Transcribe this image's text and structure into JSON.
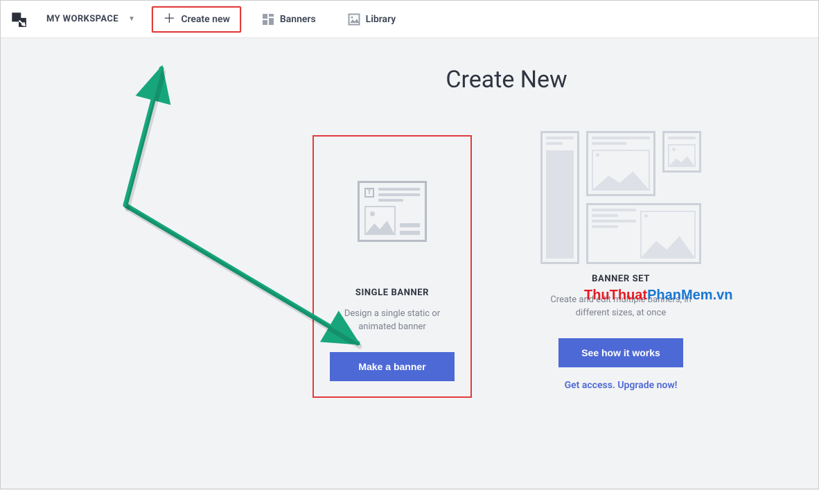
{
  "topbar": {
    "workspace_label": "MY WORKSPACE",
    "create_new_label": "Create new",
    "banners_label": "Banners",
    "library_label": "Library"
  },
  "page": {
    "title": "Create New"
  },
  "cards": {
    "single": {
      "title": "SINGLE BANNER",
      "desc": "Design a single static or animated banner",
      "button": "Make a banner"
    },
    "set": {
      "title": "BANNER SET",
      "desc": "Create and edit multiple banners, in different sizes, at once",
      "button": "See how it works",
      "upgrade_link": "Get access. Upgrade now!"
    }
  },
  "watermark": {
    "part1": "ThuThuat",
    "part2": "PhanMem",
    "part3": ".vn"
  },
  "annotation": {
    "arrow_color": "#17a67b",
    "highlight_color": "#e23b3b"
  }
}
